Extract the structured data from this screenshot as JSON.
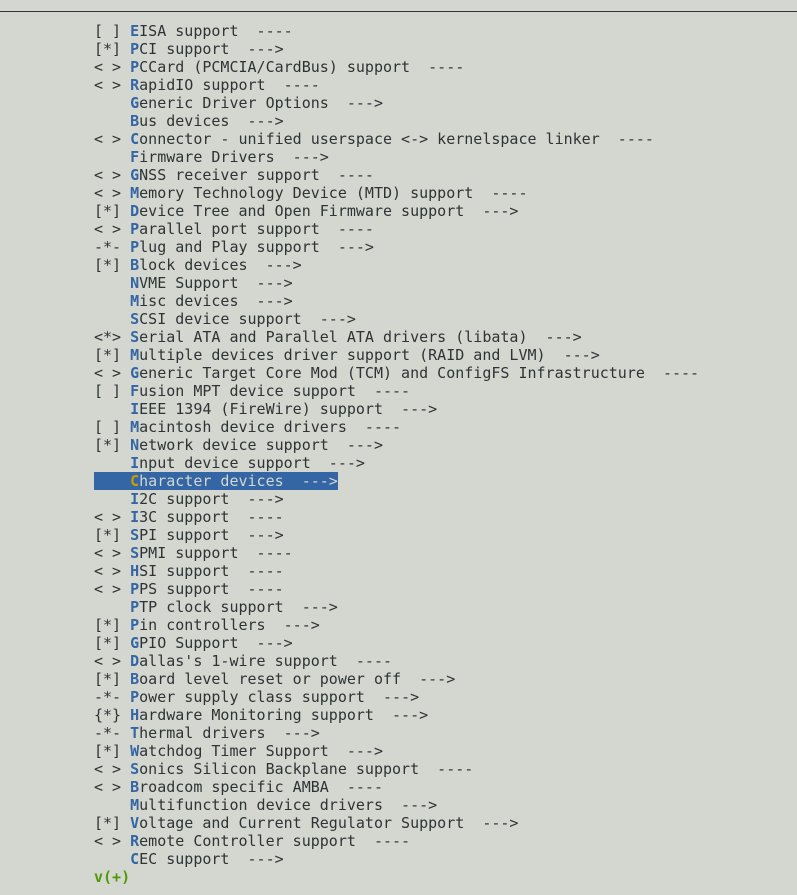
{
  "colors": {
    "background": "#d3d7cf",
    "text": "#2e3436",
    "hotkey": "#3465a4",
    "selection": "#3465a4",
    "selection_hotkey": "#c4a000",
    "more_indicator": "#4e9a06"
  },
  "selected_index": 25,
  "items": [
    {
      "prefix": "[ ] ",
      "label": "EISA support  ----"
    },
    {
      "prefix": "[*] ",
      "label": "PCI support  --->"
    },
    {
      "prefix": "< > ",
      "label": "PCCard (PCMCIA/CardBus) support  ----"
    },
    {
      "prefix": "< > ",
      "label": "RapidIO support  ----"
    },
    {
      "prefix": "    ",
      "label": "Generic Driver Options  --->"
    },
    {
      "prefix": "    ",
      "label": "Bus devices  --->"
    },
    {
      "prefix": "< > ",
      "label": "Connector - unified userspace <-> kernelspace linker  ----"
    },
    {
      "prefix": "    ",
      "label": "Firmware Drivers  --->"
    },
    {
      "prefix": "< > ",
      "label": "GNSS receiver support  ----"
    },
    {
      "prefix": "< > ",
      "label": "Memory Technology Device (MTD) support  ----"
    },
    {
      "prefix": "[*] ",
      "label": "Device Tree and Open Firmware support  --->"
    },
    {
      "prefix": "< > ",
      "label": "Parallel port support  ----"
    },
    {
      "prefix": "-*- ",
      "label": "Plug and Play support  --->"
    },
    {
      "prefix": "[*] ",
      "label": "Block devices  --->"
    },
    {
      "prefix": "    ",
      "label": "NVME Support  --->"
    },
    {
      "prefix": "    ",
      "label": "Misc devices  --->"
    },
    {
      "prefix": "    ",
      "label": "SCSI device support  --->"
    },
    {
      "prefix": "<*> ",
      "label": "Serial ATA and Parallel ATA drivers (libata)  --->"
    },
    {
      "prefix": "[*] ",
      "label": "Multiple devices driver support (RAID and LVM)  --->"
    },
    {
      "prefix": "< > ",
      "label": "Generic Target Core Mod (TCM) and ConfigFS Infrastructure  ----"
    },
    {
      "prefix": "[ ] ",
      "label": "Fusion MPT device support  ----"
    },
    {
      "prefix": "    ",
      "label": "IEEE 1394 (FireWire) support  --->"
    },
    {
      "prefix": "[ ] ",
      "label": "Macintosh device drivers  ----"
    },
    {
      "prefix": "[*] ",
      "label": "Network device support  --->"
    },
    {
      "prefix": "    ",
      "label": "Input device support  --->"
    },
    {
      "prefix": "    ",
      "label": "Character devices  --->"
    },
    {
      "prefix": "    ",
      "label": "I2C support  --->"
    },
    {
      "prefix": "< > ",
      "label": "I3C support  ----"
    },
    {
      "prefix": "[*] ",
      "label": "SPI support  --->"
    },
    {
      "prefix": "< > ",
      "label": "SPMI support  ----"
    },
    {
      "prefix": "< > ",
      "label": "HSI support  ----"
    },
    {
      "prefix": "< > ",
      "label": "PPS support  ----"
    },
    {
      "prefix": "    ",
      "label": "PTP clock support  --->"
    },
    {
      "prefix": "[*] ",
      "label": "Pin controllers  --->"
    },
    {
      "prefix": "[*] ",
      "label": "GPIO Support  --->"
    },
    {
      "prefix": "< > ",
      "label": "Dallas's 1-wire support  ----"
    },
    {
      "prefix": "[*] ",
      "label": "Board level reset or power off  --->"
    },
    {
      "prefix": "-*- ",
      "label": "Power supply class support  --->"
    },
    {
      "prefix": "{*} ",
      "label": "Hardware Monitoring support  --->"
    },
    {
      "prefix": "-*- ",
      "label": "Thermal drivers  --->"
    },
    {
      "prefix": "[*] ",
      "label": "Watchdog Timer Support  --->"
    },
    {
      "prefix": "< > ",
      "label": "Sonics Silicon Backplane support  ----"
    },
    {
      "prefix": "< > ",
      "label": "Broadcom specific AMBA  ----"
    },
    {
      "prefix": "    ",
      "label": "Multifunction device drivers  --->"
    },
    {
      "prefix": "[*] ",
      "label": "Voltage and Current Regulator Support  --->"
    },
    {
      "prefix": "< > ",
      "label": "Remote Controller support  ----"
    },
    {
      "prefix": "    ",
      "label": "CEC support  --->"
    }
  ],
  "more_indicator": "v(+)"
}
